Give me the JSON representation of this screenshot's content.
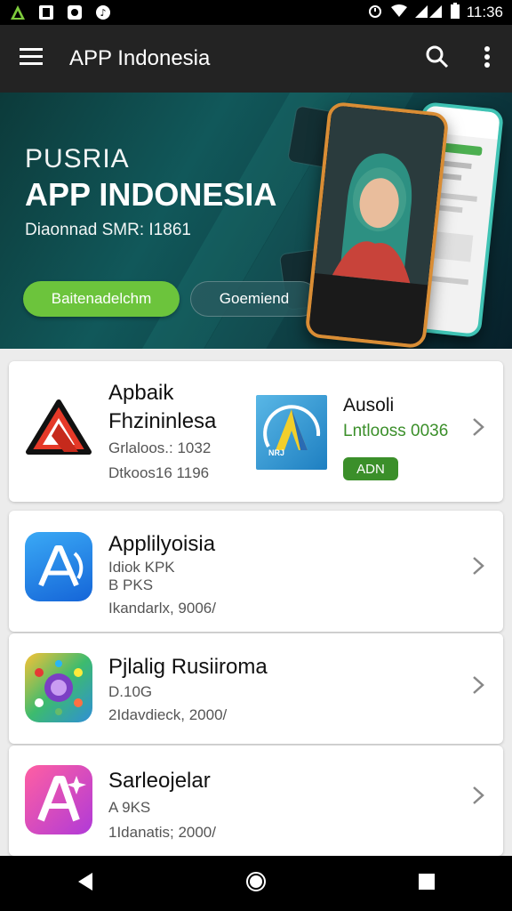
{
  "status_bar": {
    "time": "11:36"
  },
  "app_bar": {
    "title": "APP Indonesia"
  },
  "banner": {
    "subtitle": "PUSRIA",
    "title": "APP INDONESIA",
    "tagline": "Diaonnad SMR: I1861",
    "primary_button": "Baitenadelchm",
    "secondary_button": "Goemiend"
  },
  "featured_card": {
    "left_app": {
      "name_line1": "Apbaik",
      "name_line2": "Fhzininlesa",
      "meta1": "Grlaloos.: 1032",
      "meta2": "Dtkoos16 1196"
    },
    "right_app": {
      "name": "Ausoli",
      "meta": "Lntlooss 0036",
      "add_label": "ADN",
      "icon_badge": "NRJ"
    }
  },
  "app_list": [
    {
      "name": "Applilyoisia",
      "meta1": "Idiok KPK",
      "meta2": "B PKS",
      "meta3": "Ikandarlx, 9006/"
    },
    {
      "name": "Pjlalig Rusiiroma",
      "meta1": "D.10G",
      "meta2": "2Idavdieck, 2000/",
      "meta3": ""
    },
    {
      "name": "Sarleojelar",
      "meta1": "A 9KS",
      "meta2": "1Idanatis; 2000/",
      "meta3": ""
    }
  ],
  "colors": {
    "accent_green": "#6cc43c",
    "app_bar": "#232323",
    "banner_teal": "#11585a"
  }
}
